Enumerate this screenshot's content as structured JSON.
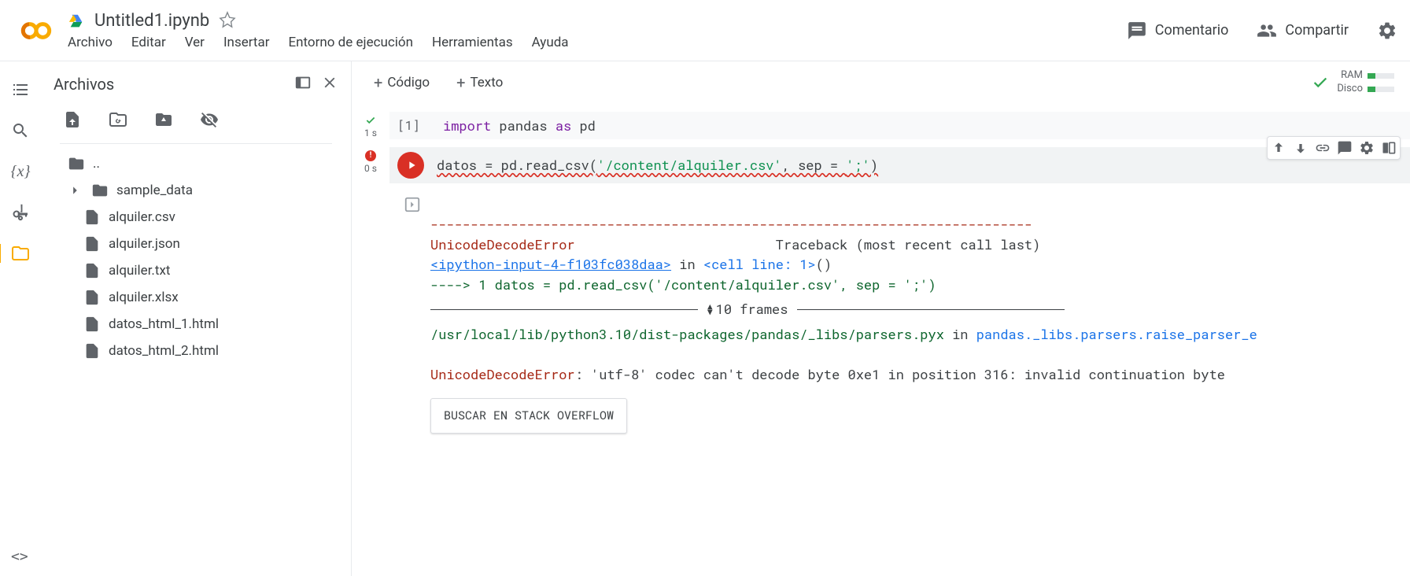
{
  "header": {
    "title": "Untitled1.ipynb",
    "menu": [
      "Archivo",
      "Editar",
      "Ver",
      "Insertar",
      "Entorno de ejecución",
      "Herramientas",
      "Ayuda"
    ],
    "comment_label": "Comentario",
    "share_label": "Compartir"
  },
  "side": {
    "title": "Archivos",
    "up_label": "..",
    "folder": "sample_data",
    "files": [
      "alquiler.csv",
      "alquiler.json",
      "alquiler.txt",
      "alquiler.xlsx",
      "datos_html_1.html",
      "datos_html_2.html"
    ]
  },
  "toolbar": {
    "code_label": "Código",
    "text_label": "Texto",
    "ram_label": "RAM",
    "disk_label": "Disco"
  },
  "cell1": {
    "gutter_time": "1 s",
    "prompt": "[1]",
    "kw_import": "import",
    "pkg": " pandas ",
    "kw_as": "as",
    "alias": " pd"
  },
  "cell2": {
    "gutter_time": "0 s",
    "code_pre": "datos = pd.read_csv(",
    "code_str": "'/content/alquiler.csv'",
    "code_mid": ", sep = ",
    "code_str2": "';'",
    "code_post": ")",
    "tb_dash": "---------------------------------------------------------------------------",
    "tb_err_name": "UnicodeDecodeError",
    "tb_traceback": "                         Traceback (most recent call last)",
    "tb_input_link": "<ipython-input-4-f103fc038daa>",
    "tb_in": " in ",
    "tb_cellline": "<cell line: 1>",
    "tb_paren": "()",
    "tb_arrow_line": "----> 1 datos = pd.read_csv('/content/alquiler.csv', sep = ';')",
    "frames_label": "10 frames",
    "tb_path": "/usr/local/lib/python3.10/dist-packages/pandas/_libs/parsers.pyx",
    "tb_in2": " in ",
    "tb_func": "pandas._libs.parsers.raise_parser_e",
    "tb_final_err": "UnicodeDecodeError",
    "tb_final_msg": ": 'utf-8' codec can't decode byte 0xe1 in position 316: invalid continuation byte",
    "so_button": "BUSCAR EN STACK OVERFLOW"
  }
}
